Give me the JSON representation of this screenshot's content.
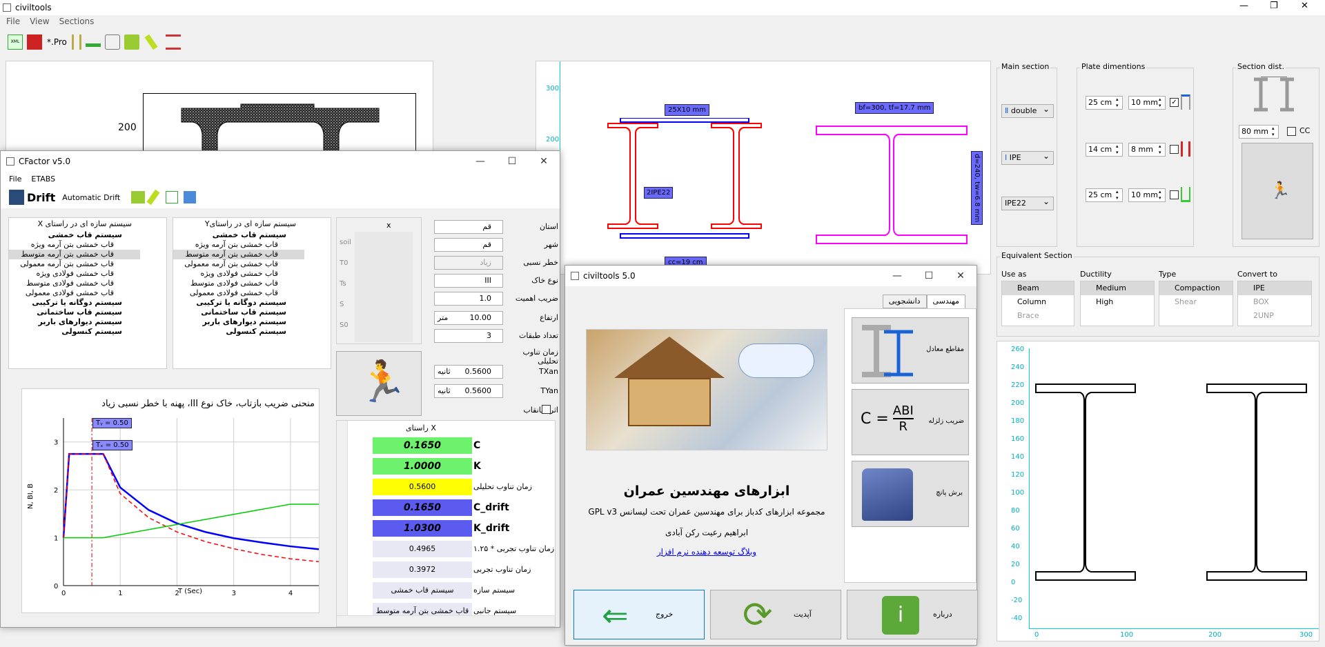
{
  "main": {
    "title": "civiltools",
    "menu": [
      "File",
      "View",
      "Sections"
    ],
    "toolbar": {
      "pro_label": "*.Pro"
    },
    "section_label": "200",
    "plot_top": {
      "labels": [
        "25X10 mm",
        "2IPE22",
        "cc=19 cm",
        "bf=300, tf=17.7 mm",
        "d=240, tw=6.8 mm"
      ],
      "y_ticks": [
        "300",
        "200"
      ]
    },
    "main_section": {
      "label": "Main section",
      "type": "double",
      "profile": "IPE",
      "size": "IPE22"
    },
    "plate": {
      "label": "Plate dimentions",
      "rows": [
        {
          "a": "25 cm",
          "b": "10 mm",
          "checked": true
        },
        {
          "a": "14 cm",
          "b": "8 mm",
          "checked": false
        },
        {
          "a": "25 cm",
          "b": "10 mm",
          "checked": false
        }
      ]
    },
    "section_dist": {
      "label": "Section dist.",
      "value": "80 mm",
      "cc": "CC"
    },
    "equivalent": {
      "label": "Equivalent Section",
      "use_as": {
        "label": "Use as",
        "items": [
          "Beam",
          "Column",
          "Brace"
        ]
      },
      "ductility": {
        "label": "Ductility",
        "items": [
          "Medium",
          "High"
        ]
      },
      "type": {
        "label": "Type",
        "items": [
          "Compaction",
          "Shear"
        ]
      },
      "convert": {
        "label": "Convert to",
        "items": [
          "IPE",
          "BOX",
          "2UNP"
        ]
      }
    },
    "bottom_plot": {
      "y_ticks": [
        "260",
        "240",
        "220",
        "200",
        "180",
        "160",
        "140",
        "120",
        "100",
        "80",
        "60",
        "40",
        "20",
        "0",
        "-20",
        "-40"
      ],
      "x_ticks": [
        "0",
        "100",
        "200",
        "300"
      ]
    }
  },
  "cfactor": {
    "title": "CFactor v5.0",
    "menu": [
      "File",
      "ETABS"
    ],
    "toolbar": {
      "drift": "Drift",
      "auto_drift": "Automatic Drift"
    },
    "tree_x": {
      "header": "سیستم سازه ای در راستای X",
      "items": [
        {
          "t": "سیستم قاب خمشی",
          "b": true
        },
        {
          "t": "قاب خمشی بتن آرمه ویژه"
        },
        {
          "t": "قاب خمشی بتن آرمه متوسط",
          "sel": true
        },
        {
          "t": "قاب خمشی بتن آرمه معمولی"
        },
        {
          "t": "قاب خمشی فولادی ویژه"
        },
        {
          "t": "قاب خمشی فولادی متوسط"
        },
        {
          "t": "قاب خمشی فولادی معمولی"
        },
        {
          "t": "سیستم دوگانه یا ترکیبی",
          "b": true
        },
        {
          "t": "سیستم قاب ساختمانی",
          "b": true
        },
        {
          "t": "سیستم دیوارهای باربر",
          "b": true
        },
        {
          "t": "سیستم کنسولی",
          "b": true
        }
      ]
    },
    "tree_y": {
      "header": "سیستم سازه ای در راستایY",
      "items": [
        {
          "t": "سیستم قاب خمشی",
          "b": true
        },
        {
          "t": "قاب خمشی بتن آرمه ویژه"
        },
        {
          "t": "قاب خمشی بتن آرمه متوسط",
          "sel": true
        },
        {
          "t": "قاب خمشی بتن آرمه معمولی"
        },
        {
          "t": "قاب خمشی فولادی ویژه"
        },
        {
          "t": "قاب خمشی فولادی متوسط"
        },
        {
          "t": "قاب خمشی فولادی معمولی"
        },
        {
          "t": "سیستم دوگانه یا ترکیبی",
          "b": true
        },
        {
          "t": "سیستم قاب ساختمانی",
          "b": true
        },
        {
          "t": "سیستم دیوارهای باربر",
          "b": true
        },
        {
          "t": "سیستم کنسولی",
          "b": true
        }
      ]
    },
    "soil_table": {
      "header": "x",
      "rows": [
        "soil",
        "T0",
        "Ts",
        "S",
        "S0"
      ]
    },
    "params": [
      {
        "label": "استان",
        "value": "قم"
      },
      {
        "label": "شهر",
        "value": "قم"
      },
      {
        "label": "خطر نسبی",
        "value": "زیاد"
      },
      {
        "label": "نوع خاک",
        "value": "III"
      },
      {
        "label": "ضریب اهمیت",
        "value": "1.0"
      },
      {
        "label": "ارتفاع",
        "value": "10.00",
        "unit": "متر"
      },
      {
        "label": "تعداد طبقات",
        "value": "3"
      },
      {
        "label": "زمان تناوب تحلیلی",
        "value": ""
      },
      {
        "label": "TXan",
        "value": "0.5600",
        "unit": "ثانیه"
      },
      {
        "label": "TYan",
        "value": "0.5600",
        "unit": "ثانیه"
      },
      {
        "label": "اثر میانقاب",
        "value": ""
      }
    ],
    "chart_title": "منحنی ضریب بازتاب، خاک نوع III، پهنه با خطر نسبی زیاد",
    "chart_tags": [
      "Tᵧ = 0.50",
      "Tₓ = 0.50"
    ],
    "results": {
      "header": "راستای X",
      "rows": [
        {
          "v": "0.1650",
          "l": "C",
          "c": "#6ef26e",
          "bold": true
        },
        {
          "v": "1.0000",
          "l": "K",
          "c": "#6ef26e",
          "bold": true
        },
        {
          "v": "0.5600",
          "l": "زمان تناوب تحلیلی",
          "c": "#ffff00"
        },
        {
          "v": "0.1650",
          "l": "C_drift",
          "c": "#5b5bf0",
          "bold": true
        },
        {
          "v": "1.0300",
          "l": "K_drift",
          "c": "#5b5bf0",
          "bold": true
        },
        {
          "v": "0.4965",
          "l": "زمان تناوب تجربی * ۱.۲۵",
          "c": "#e8e8f5"
        },
        {
          "v": "0.3972",
          "l": "زمان تناوب تجربی",
          "c": "#e8e8f5"
        },
        {
          "v": "سیستم قاب خمشی",
          "l": "سیستم سازه",
          "c": "#e8e8f5"
        },
        {
          "v": "قاب خمشی بتن آرمه متوسط",
          "l": "سیستم جانبی",
          "c": "#e8e8f5"
        }
      ]
    }
  },
  "chart_data": {
    "type": "line",
    "title": "منحنی ضریب بازتاب، خاک نوع III، پهنه با خطر نسبی زیاد",
    "xlabel": "T (Sec)",
    "ylabel": "N, BI, B",
    "xlim": [
      0,
      4.5
    ],
    "ylim": [
      0,
      3.5
    ],
    "x_ticks": [
      "0",
      "1",
      "2",
      "3",
      "4"
    ],
    "y_ticks": [
      "0",
      "1",
      "2",
      "3"
    ],
    "series": [
      {
        "color": "#0000ff",
        "x": [
          0,
          0.1,
          0.5,
          0.7,
          1,
          1.5,
          2,
          2.5,
          3,
          3.5,
          4,
          4.5
        ],
        "y": [
          1,
          2.75,
          2.75,
          2.75,
          2.05,
          1.58,
          1.3,
          1.12,
          0.99,
          0.9,
          0.82,
          0.76
        ]
      },
      {
        "color": "#ff0000",
        "x": [
          0,
          0.1,
          0.5,
          0.7,
          1,
          1.5,
          2,
          2.5,
          3,
          3.5,
          4,
          4.5
        ],
        "y": [
          1,
          2.75,
          2.75,
          2.75,
          1.92,
          1.42,
          1.12,
          0.92,
          0.77,
          0.65,
          0.56,
          0.5
        ]
      },
      {
        "color": "#00cc00",
        "x": [
          0,
          0.7,
          4,
          4.5
        ],
        "y": [
          1,
          1,
          1.7,
          1.7
        ]
      }
    ],
    "tx": 0.5
  },
  "about": {
    "title": "civiltools 5.0",
    "tabs": [
      "مهندسی",
      "دانشجویی"
    ],
    "heading": "ابزارهای مهندسین عمران",
    "desc": "مجموعه ابزارهای کدباز برای مهندسین عمران تحت لیسانس GPL v3",
    "author": "ابراهیم رعیت رکن آبادی",
    "link": "وبلاگ توسعه دهنده نرم افزار",
    "tools": [
      {
        "label": "مقاطع معادل"
      },
      {
        "label": "ضریب زلزله",
        "formula": "C = ABI / R"
      },
      {
        "label": "برش پانچ"
      }
    ],
    "buttons": [
      "خروج",
      "آپدیت",
      "درباره"
    ]
  }
}
